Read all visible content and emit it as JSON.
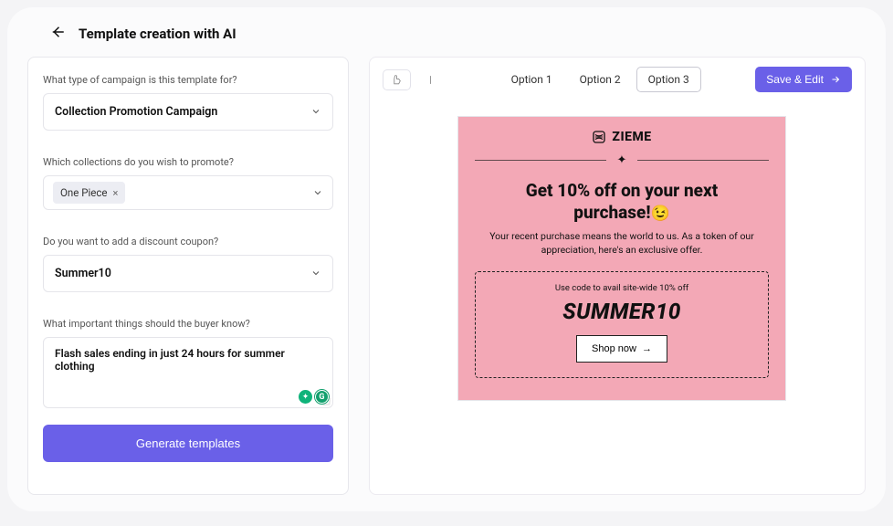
{
  "header": {
    "title": "Template creation with AI"
  },
  "form": {
    "campaign_type": {
      "label": "What type of campaign is this template for?",
      "value": "Collection Promotion Campaign"
    },
    "collections": {
      "label": "Which collections do you wish to promote?",
      "chip": "One Piece"
    },
    "coupon": {
      "label": "Do you want to add a discount coupon?",
      "value": "Summer10"
    },
    "important": {
      "label": "What important things should the buyer know?",
      "value": "Flash sales ending in just 24 hours for summer clothing"
    },
    "generate_button": "Generate templates",
    "grammarly_badge": "G"
  },
  "toolbar": {
    "options": [
      "Option 1",
      "Option 2",
      "Option 3"
    ],
    "active_index": 2,
    "save_label": "Save & Edit"
  },
  "email": {
    "brand": "ZIEME",
    "title_line1": "Get 10% off on your next",
    "title_line2": "purchase!",
    "emoji": "😉",
    "subtitle": "Your recent purchase means the world to us. As a token of our appreciation, here's an exclusive offer.",
    "coupon_caption": "Use code to avail site-wide 10% off",
    "coupon_code": "SUMMER10",
    "shop_label": "Shop now"
  }
}
